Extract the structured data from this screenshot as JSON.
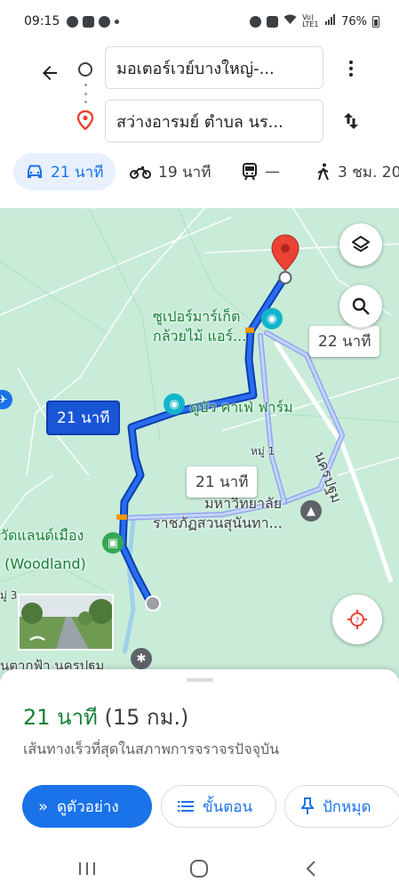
{
  "status_bar": {
    "time": "09:15",
    "network_label": "Vo) LTE1",
    "battery": "76%"
  },
  "directions": {
    "origin_value": "มอเตอร์เวย์บางใหญ่-...",
    "destination_value": "สว่างอารมย์ ตำบล นร...",
    "icons": {
      "back": "arrow-left-icon",
      "origin": "circle-outline-icon",
      "destination": "location-pin-icon",
      "more": "more-vertical-icon",
      "swap": "swap-vertical-icon"
    }
  },
  "travel_modes": [
    {
      "icon": "car-icon",
      "label": "21 นาที",
      "active": true
    },
    {
      "icon": "motorcycle-icon",
      "label": "19 นาที",
      "active": false
    },
    {
      "icon": "transit-icon",
      "label": "—",
      "active": false
    },
    {
      "icon": "walk-icon",
      "label": "3 ชม. 20",
      "active": false
    }
  ],
  "map": {
    "labels": {
      "supermarket": "ซูเปอร์มาร์เก็ต",
      "supermarket_2": "กล้วยไม้ แอร์...",
      "cafe": "ดูบัว คาเฟ่ ฟาร์ม",
      "village": "หมู่ 1",
      "road": "นครปฐม",
      "university_1": "มหาวิทยาลัย",
      "university_2": "ราชภัฏสวนสุนันทา...",
      "woodland_1": "วัดแลนด์เมือง",
      "woodland_2": "ู (Woodland)",
      "moo3": "มู่ 3",
      "bottom_place": "นตากฟ้า นครปฐม"
    },
    "route_chips": {
      "primary": "21 นาที",
      "alt_1": "22 นาที",
      "alt_2": "21 นาที"
    },
    "buttons": {
      "layers": "layers-icon",
      "search": "search-icon",
      "locate": "my-location-icon"
    }
  },
  "route_summary": {
    "duration": "21 นาที",
    "distance": "(15 กม.)",
    "description": "เส้นทางเร็วที่สุดในสภาพการจราจรปัจจุบัน",
    "buttons": {
      "preview": "ดูตัวอย่าง",
      "steps": "ขั้นตอน",
      "pin": "ปักหมุด"
    }
  },
  "colors": {
    "accent": "#1a73e8",
    "route": "#1a55d6",
    "duration": "#188038",
    "map_bg": "#c8ecd8",
    "destination_pin": "#ea4335"
  }
}
